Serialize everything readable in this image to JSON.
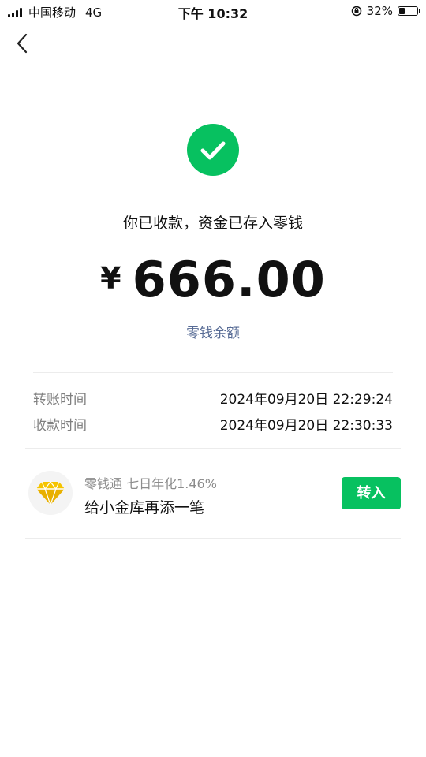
{
  "status_bar": {
    "carrier": "中国移动",
    "network": "4G",
    "time": "下午 10:32",
    "battery_percent": "32%",
    "battery_level": 0.32,
    "icons": [
      "signal-icon",
      "rotation-lock-icon",
      "battery-icon"
    ]
  },
  "header": {
    "back_icon": "chevron-left-icon"
  },
  "result": {
    "icon": "check-icon",
    "accent_color": "#07c160",
    "message": "你已收款，资金已存入零钱",
    "currency_symbol": "¥",
    "amount": "666.00",
    "balance_link": "零钱余额",
    "link_color": "#576b95"
  },
  "details": [
    {
      "label": "转账时间",
      "value": "2024年09月20日 22:29:24"
    },
    {
      "label": "收款时间",
      "value": "2024年09月20日 22:30:33"
    }
  ],
  "promo": {
    "icon": "diamond-icon",
    "subtitle": "零钱通 七日年化1.46%",
    "title": "给小金库再添一笔",
    "button_label": "转入"
  }
}
